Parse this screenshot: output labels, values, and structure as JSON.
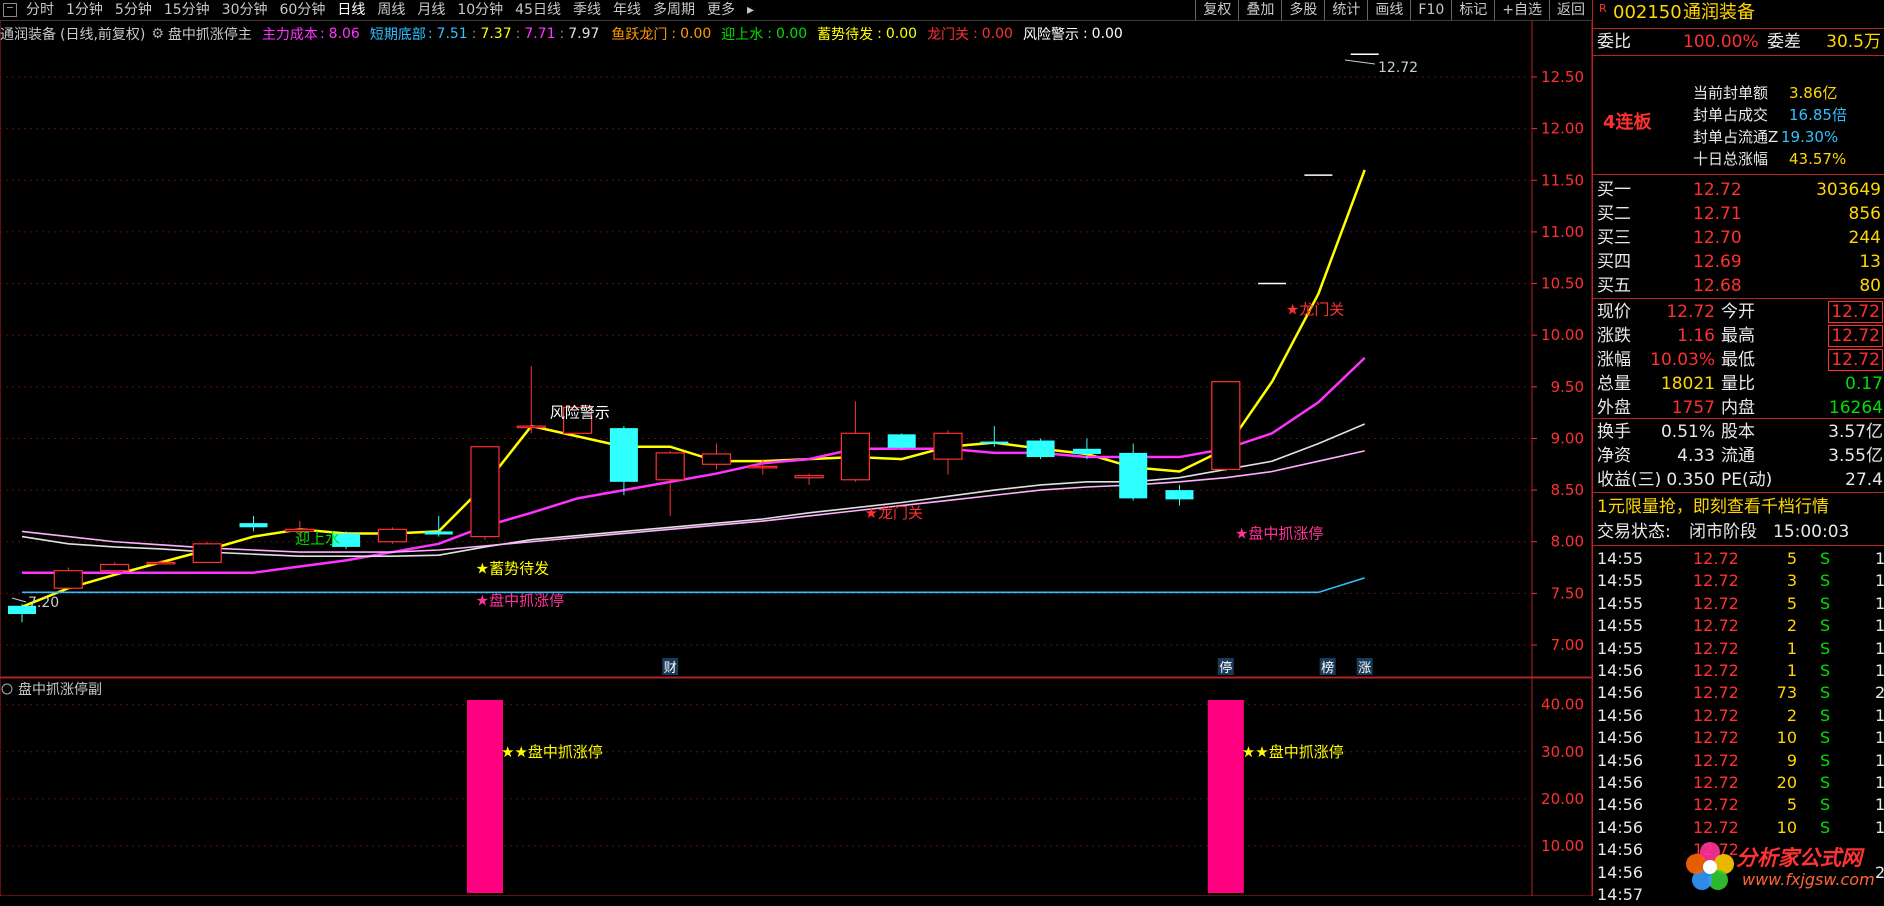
{
  "toolbar": {
    "periods": [
      "分时",
      "1分钟",
      "5分钟",
      "15分钟",
      "30分钟",
      "60分钟",
      "日线",
      "周线",
      "月线",
      "10分钟",
      "45日线",
      "季线",
      "年线",
      "多周期",
      "更多"
    ],
    "active_period": "日线",
    "buttons": [
      "复权",
      "叠加",
      "多股",
      "统计",
      "画线",
      "F10",
      "标记",
      "+自选",
      "返回"
    ]
  },
  "info": {
    "stock": "通润装备",
    "mode": "(日线,前复权)",
    "formula": "盘中抓涨停主",
    "ma_label": "主力成本",
    "ma_value": "8.06",
    "short_label": "短期底部",
    "short_values": "7.51",
    "v2": "7.37",
    "v3": "7.71",
    "v4": "7.97",
    "l1": "鱼跃龙门",
    "l1v": "0.00",
    "l2": "迎上水",
    "l2v": "0.00",
    "l3": "蓄势待发",
    "l3v": "0.00",
    "l4": "龙门关",
    "l4v": "0.00",
    "l5": "风险警示",
    "l5v": "0.00"
  },
  "chart_data": {
    "type": "candlestick",
    "ylim": [
      6.7,
      12.8
    ],
    "y_ticks": [
      "12.50",
      "12.00",
      "11.50",
      "11.00",
      "10.50",
      "10.00",
      "9.50",
      "9.00",
      "8.50",
      "8.00",
      "7.50",
      "7.00"
    ],
    "y_tick_values": [
      12.5,
      12.0,
      11.5,
      11.0,
      10.5,
      10.0,
      9.5,
      9.0,
      8.5,
      8.0,
      7.5,
      7.0
    ],
    "candles": [
      {
        "o": 7.38,
        "c": 7.3,
        "h": 7.4,
        "l": 7.22
      },
      {
        "o": 7.55,
        "c": 7.72,
        "h": 7.75,
        "l": 7.55
      },
      {
        "o": 7.72,
        "c": 7.78,
        "h": 7.8,
        "l": 7.7
      },
      {
        "o": 7.8,
        "c": 7.8,
        "h": 7.82,
        "l": 7.78
      },
      {
        "o": 7.8,
        "c": 7.98,
        "h": 8.0,
        "l": 7.8
      },
      {
        "o": 8.18,
        "c": 8.14,
        "h": 8.25,
        "l": 8.1
      },
      {
        "o": 8.1,
        "c": 8.12,
        "h": 8.2,
        "l": 8.05
      },
      {
        "o": 8.08,
        "c": 7.95,
        "h": 8.1,
        "l": 7.93
      },
      {
        "o": 8.0,
        "c": 8.12,
        "h": 8.14,
        "l": 7.98
      },
      {
        "o": 8.1,
        "c": 8.07,
        "h": 8.25,
        "l": 8.05
      },
      {
        "o": 8.05,
        "c": 8.92,
        "h": 8.92,
        "l": 8.02
      },
      {
        "o": 9.12,
        "c": 9.12,
        "h": 9.7,
        "l": 9.05
      },
      {
        "o": 9.05,
        "c": 9.3,
        "h": 9.3,
        "l": 9.05
      },
      {
        "o": 9.1,
        "c": 8.58,
        "h": 9.12,
        "l": 8.45
      },
      {
        "o": 8.6,
        "c": 8.86,
        "h": 8.88,
        "l": 8.25
      },
      {
        "o": 8.75,
        "c": 8.85,
        "h": 8.95,
        "l": 8.7
      },
      {
        "o": 8.72,
        "c": 8.73,
        "h": 8.8,
        "l": 8.65
      },
      {
        "o": 8.62,
        "c": 8.64,
        "h": 8.66,
        "l": 8.55
      },
      {
        "o": 8.6,
        "c": 9.05,
        "h": 9.36,
        "l": 8.58
      },
      {
        "o": 9.04,
        "c": 8.91,
        "h": 9.05,
        "l": 8.9
      },
      {
        "o": 8.8,
        "c": 9.05,
        "h": 9.08,
        "l": 8.65
      },
      {
        "o": 8.97,
        "c": 8.95,
        "h": 9.12,
        "l": 8.92
      },
      {
        "o": 8.98,
        "c": 8.82,
        "h": 9.0,
        "l": 8.8
      },
      {
        "o": 8.9,
        "c": 8.85,
        "h": 9.0,
        "l": 8.8
      },
      {
        "o": 8.86,
        "c": 8.42,
        "h": 8.95,
        "l": 8.4
      },
      {
        "o": 8.5,
        "c": 8.41,
        "h": 8.55,
        "l": 8.35
      },
      {
        "o": 8.7,
        "c": 9.55,
        "h": 9.55,
        "l": 8.68
      },
      {
        "o": 10.5,
        "c": 10.5,
        "h": 10.5,
        "l": 10.5
      },
      {
        "o": 11.55,
        "c": 11.55,
        "h": 11.55,
        "l": 11.55
      },
      {
        "o": 12.72,
        "c": 12.72,
        "h": 12.72,
        "l": 12.72
      }
    ],
    "series": [
      {
        "name": "主力成本",
        "color": "#ffff00",
        "values": [
          7.37,
          7.55,
          7.68,
          7.8,
          7.92,
          8.05,
          8.12,
          8.08,
          8.08,
          8.1,
          8.55,
          9.12,
          9.02,
          8.92,
          8.92,
          8.78,
          8.78,
          8.8,
          8.82,
          8.8,
          8.92,
          8.96,
          8.9,
          8.85,
          8.72,
          8.68,
          8.9,
          9.55,
          10.4,
          11.6
        ]
      },
      {
        "name": "短期底部",
        "color": "#ff33ff",
        "values": [
          7.7,
          7.7,
          7.7,
          7.7,
          7.7,
          7.7,
          7.76,
          7.82,
          7.9,
          7.98,
          8.15,
          8.28,
          8.42,
          8.5,
          8.58,
          8.66,
          8.76,
          8.8,
          8.9,
          8.9,
          8.9,
          8.86,
          8.86,
          8.82,
          8.82,
          8.82,
          8.9,
          9.05,
          9.35,
          9.78
        ]
      },
      {
        "name": "7.37",
        "color": "#e0e0e0",
        "values": [
          8.05,
          7.98,
          7.95,
          7.93,
          7.9,
          7.88,
          7.86,
          7.86,
          7.86,
          7.87,
          7.95,
          8.02,
          8.06,
          8.1,
          8.14,
          8.18,
          8.22,
          8.28,
          8.33,
          8.38,
          8.44,
          8.5,
          8.55,
          8.58,
          8.58,
          8.62,
          8.7,
          8.78,
          8.95,
          9.14
        ]
      },
      {
        "name": "7.71",
        "color": "#ffb0ff",
        "values": [
          8.1,
          8.05,
          8.0,
          7.97,
          7.94,
          7.92,
          7.9,
          7.9,
          7.9,
          7.92,
          7.96,
          8.0,
          8.04,
          8.08,
          8.12,
          8.16,
          8.2,
          8.25,
          8.3,
          8.35,
          8.4,
          8.45,
          8.5,
          8.53,
          8.55,
          8.58,
          8.62,
          8.68,
          8.78,
          8.88
        ]
      },
      {
        "name": "7.51",
        "color": "#30c0ff",
        "values": [
          7.51,
          7.51,
          7.51,
          7.51,
          7.51,
          7.51,
          7.51,
          7.51,
          7.51,
          7.51,
          7.51,
          7.51,
          7.51,
          7.51,
          7.51,
          7.51,
          7.51,
          7.51,
          7.51,
          7.51,
          7.51,
          7.51,
          7.51,
          7.51,
          7.51,
          7.51,
          7.51,
          7.51,
          7.51,
          7.65
        ]
      }
    ],
    "annotations": [
      {
        "text": "风险警示",
        "idx": 11.7,
        "y": 9.25,
        "color": "#ffffff"
      },
      {
        "text": "迎上水",
        "idx": 6.2,
        "y": 8.03,
        "color": "#00e000"
      },
      {
        "text": "★蓄势待发",
        "idx": 10.1,
        "y": 7.74,
        "color": "#ffff00"
      },
      {
        "text": "★盘中抓涨停",
        "idx": 10.1,
        "y": 7.43,
        "color": "#ff3399"
      },
      {
        "text": "★龙门关",
        "idx": 18.5,
        "y": 8.28,
        "color": "#ff3030"
      },
      {
        "text": "★盘中抓涨停",
        "idx": 26.5,
        "y": 8.08,
        "color": "#ff3399"
      },
      {
        "text": "★龙门关",
        "idx": 27.6,
        "y": 10.25,
        "color": "#ff3030"
      }
    ],
    "price_labels": {
      "high": "12.72",
      "low": "7.20"
    },
    "date_markers": [
      {
        "text": "财",
        "idx": 14
      },
      {
        "text": "停",
        "idx": 26
      },
      {
        "text": "榜",
        "idx": 28.2
      },
      {
        "text": "涨",
        "idx": 29
      }
    ],
    "sub": {
      "title": "盘中抓涨停副",
      "ylim": [
        0,
        41
      ],
      "y_ticks": [
        "40.00",
        "30.00",
        "20.00",
        "10.00"
      ],
      "y_tick_values": [
        40,
        30,
        20,
        10
      ],
      "bars": [
        {
          "idx": 10,
          "value": 41
        },
        {
          "idx": 26,
          "value": 41
        }
      ],
      "label": "★★盘中抓涨停",
      "label_value": 30
    }
  },
  "quote": {
    "code": "002150",
    "name": "通润装备",
    "wb_label": "委比",
    "wb": "100.00%",
    "wc_label": "委差",
    "wc": "30.5万",
    "badge": "4连板",
    "seal": [
      {
        "k": "当前封单额",
        "v": "3.86亿"
      },
      {
        "k": "封单占成交",
        "v": "16.85倍"
      },
      {
        "k": "封单占流通Z",
        "v": "19.30%"
      },
      {
        "k": "十日总涨幅",
        "v": "43.57%"
      }
    ],
    "bids": [
      {
        "k": "买一",
        "p": "12.72",
        "v": "303649"
      },
      {
        "k": "买二",
        "p": "12.71",
        "v": "856"
      },
      {
        "k": "买三",
        "p": "12.70",
        "v": "244"
      },
      {
        "k": "买四",
        "p": "12.69",
        "v": "13"
      },
      {
        "k": "买五",
        "p": "12.68",
        "v": "80"
      }
    ],
    "stats": [
      {
        "k1": "现价",
        "v1": "12.72",
        "k2": "今开",
        "v2": "12.72",
        "c1": "red",
        "c2": "red"
      },
      {
        "k1": "涨跌",
        "v1": "1.16",
        "k2": "最高",
        "v2": "12.72",
        "c1": "red",
        "c2": "red"
      },
      {
        "k1": "涨幅",
        "v1": "10.03%",
        "k2": "最低",
        "v2": "12.72",
        "c1": "red",
        "c2": "red"
      },
      {
        "k1": "总量",
        "v1": "18021",
        "k2": "量比",
        "v2": "0.17",
        "c1": "yel",
        "c2": "grn"
      },
      {
        "k1": "外盘",
        "v1": "1757",
        "k2": "内盘",
        "v2": "16264",
        "c1": "red",
        "c2": "grn"
      }
    ],
    "stats2": [
      {
        "k1": "换手",
        "v1": "0.51%",
        "k2": "股本",
        "v2": "3.57亿"
      },
      {
        "k1": "净资",
        "v1": "4.33",
        "k2": "流通",
        "v2": "3.55亿"
      },
      {
        "k1": "收益(三)",
        "v1": "0.350",
        "k2": "PE(动)",
        "v2": "27.4"
      }
    ],
    "promo": "1元限量抢，即刻查看千档行情",
    "status_label": "交易状态:",
    "status": "闭市阶段",
    "status_time": "15:00:03",
    "ticks": [
      {
        "t": "14:55",
        "p": "12.72",
        "v": "5",
        "s": "S",
        "n": "1"
      },
      {
        "t": "14:55",
        "p": "12.72",
        "v": "3",
        "s": "S",
        "n": "1"
      },
      {
        "t": "14:55",
        "p": "12.72",
        "v": "5",
        "s": "S",
        "n": "1"
      },
      {
        "t": "14:55",
        "p": "12.72",
        "v": "2",
        "s": "S",
        "n": "1"
      },
      {
        "t": "14:55",
        "p": "12.72",
        "v": "1",
        "s": "S",
        "n": "1"
      },
      {
        "t": "14:56",
        "p": "12.72",
        "v": "1",
        "s": "S",
        "n": "1"
      },
      {
        "t": "14:56",
        "p": "12.72",
        "v": "73",
        "s": "S",
        "n": "2"
      },
      {
        "t": "14:56",
        "p": "12.72",
        "v": "2",
        "s": "S",
        "n": "1"
      },
      {
        "t": "14:56",
        "p": "12.72",
        "v": "10",
        "s": "S",
        "n": "1"
      },
      {
        "t": "14:56",
        "p": "12.72",
        "v": "9",
        "s": "S",
        "n": "1"
      },
      {
        "t": "14:56",
        "p": "12.72",
        "v": "20",
        "s": "S",
        "n": "1"
      },
      {
        "t": "14:56",
        "p": "12.72",
        "v": "5",
        "s": "S",
        "n": "1"
      },
      {
        "t": "14:56",
        "p": "12.72",
        "v": "10",
        "s": "S",
        "n": "1"
      },
      {
        "t": "14:56",
        "p": "12.72",
        "v": "",
        "s": "",
        "n": ""
      },
      {
        "t": "14:56",
        "p": "",
        "v": "",
        "s": "",
        "n": "2"
      },
      {
        "t": "14:57",
        "p": "",
        "v": "",
        "s": "",
        "n": ""
      }
    ],
    "logo_text": "分析家公式网",
    "logo_url": "www.fxjgsw.com"
  }
}
